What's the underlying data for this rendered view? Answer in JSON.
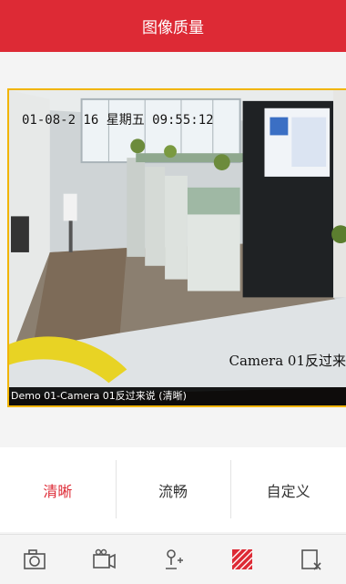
{
  "header": {
    "title": "图像质量"
  },
  "video": {
    "osd_time": "01-08-2 16 星期五 09:55:12",
    "osd_camera": "Camera 01反过来",
    "caption": "Demo 01-Camera 01反过来说 (清晰)"
  },
  "quality_options": [
    "清晰",
    "流畅",
    "自定义"
  ],
  "selected_quality": "清晰",
  "colors": {
    "accent": "#dd2a35",
    "video_border": "#f1b400"
  },
  "toolbar": {
    "icons": [
      "camera-icon",
      "video-record-icon",
      "ptz-icon",
      "quality-icon",
      "close-window-icon"
    ]
  }
}
